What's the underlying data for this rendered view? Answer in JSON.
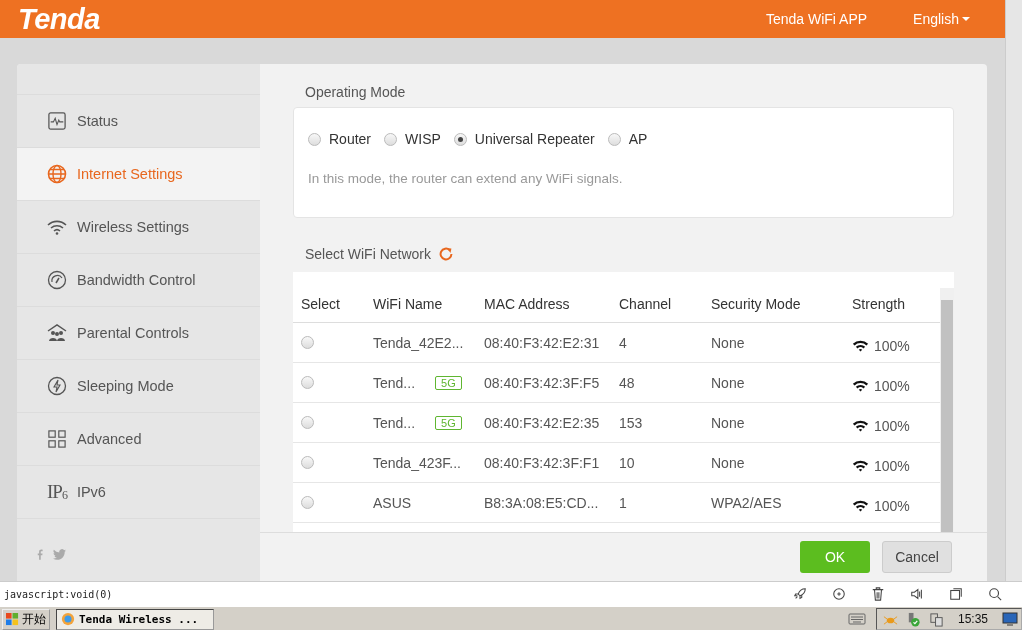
{
  "header": {
    "logo": "Tenda",
    "app_link": "Tenda WiFi APP",
    "language": "English"
  },
  "sidebar": {
    "items": [
      {
        "label": "Status",
        "kind": "status",
        "selected": false
      },
      {
        "label": "Internet Settings",
        "kind": "internet",
        "selected": true
      },
      {
        "label": "Wireless Settings",
        "kind": "wireless",
        "selected": false
      },
      {
        "label": "Bandwidth Control",
        "kind": "bandwidth",
        "selected": false
      },
      {
        "label": "Parental Controls",
        "kind": "parental",
        "selected": false
      },
      {
        "label": "Sleeping Mode",
        "kind": "sleeping",
        "selected": false
      },
      {
        "label": "Advanced",
        "kind": "advanced",
        "selected": false
      },
      {
        "label": "IPv6",
        "kind": "ipv6",
        "icon_text": "IP",
        "icon_sub": "6",
        "selected": false
      }
    ]
  },
  "operating_mode": {
    "title": "Operating Mode",
    "options": [
      {
        "label": "Router",
        "selected": false
      },
      {
        "label": "WISP",
        "selected": false
      },
      {
        "label": "Universal Repeater",
        "selected": true
      },
      {
        "label": "AP",
        "selected": false
      }
    ],
    "description": "In this mode, the router can extend any WiFi signals."
  },
  "wifi_network": {
    "title": "Select WiFi Network",
    "columns": [
      "Select",
      "WiFi Name",
      "MAC Address",
      "Channel",
      "Security Mode",
      "Strength"
    ],
    "rows": [
      {
        "selected": false,
        "name": "Tenda_42E2...",
        "band": "",
        "mac": "08:40:F3:42:E2:31",
        "channel": "4",
        "security": "None",
        "strength": "100%"
      },
      {
        "selected": false,
        "name": "Tend...",
        "band": "5G",
        "mac": "08:40:F3:42:3F:F5",
        "channel": "48",
        "security": "None",
        "strength": "100%"
      },
      {
        "selected": false,
        "name": "Tend...",
        "band": "5G",
        "mac": "08:40:F3:42:E2:35",
        "channel": "153",
        "security": "None",
        "strength": "100%"
      },
      {
        "selected": false,
        "name": "Tenda_423F...",
        "band": "",
        "mac": "08:40:F3:42:3F:F1",
        "channel": "10",
        "security": "None",
        "strength": "100%"
      },
      {
        "selected": false,
        "name": "ASUS",
        "band": "",
        "mac": "B8:3A:08:E5:CD...",
        "channel": "1",
        "security": "WPA2/AES",
        "strength": "100%"
      }
    ]
  },
  "buttons": {
    "ok": "OK",
    "cancel": "Cancel"
  },
  "status_bar": {
    "text": "javascript:void(0)"
  },
  "taskbar": {
    "start": "开始",
    "task": "Tenda Wireless ...",
    "time": "15:35"
  }
}
